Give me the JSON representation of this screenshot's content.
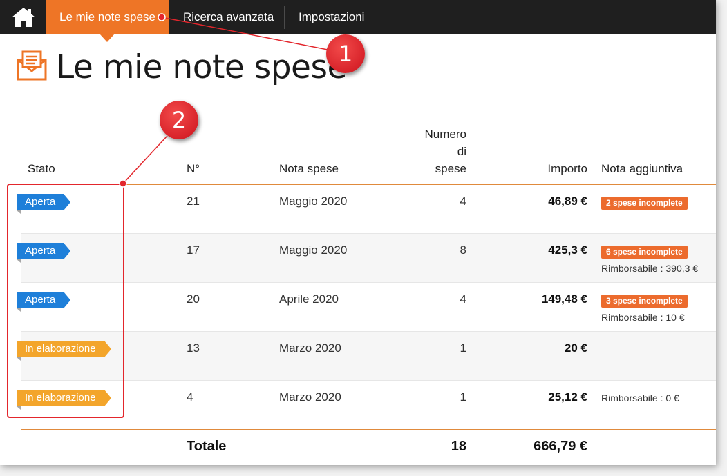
{
  "nav": {
    "home_icon": "home-icon",
    "items": [
      {
        "label": "Le mie note spese",
        "active": true
      },
      {
        "label": "Ricerca avanzata",
        "active": false
      },
      {
        "label": "Impostazioni",
        "active": false
      }
    ]
  },
  "page": {
    "title": "Le mie note spese",
    "title_icon": "expense-note-icon"
  },
  "table": {
    "headers": {
      "stato": "Stato",
      "numero": "N°",
      "nota_spese": "Nota spese",
      "numero_di_spese_1": "Numero",
      "numero_di_spese_2": "di",
      "numero_di_spese_3": "spese",
      "importo": "Importo",
      "nota_aggiuntiva": "Nota aggiuntiva"
    },
    "rows": [
      {
        "stato": "Aperta",
        "stato_color": "#1e7fd9",
        "n": "21",
        "nota": "Maggio 2020",
        "num_spese": "4",
        "importo": "46,89 €",
        "badge": "2 spese incomplete",
        "note": ""
      },
      {
        "stato": "Aperta",
        "stato_color": "#1e7fd9",
        "n": "17",
        "nota": "Maggio 2020",
        "num_spese": "8",
        "importo": "425,3 €",
        "badge": "6 spese incomplete",
        "note": "Rimborsabile : 390,3 €"
      },
      {
        "stato": "Aperta",
        "stato_color": "#1e7fd9",
        "n": "20",
        "nota": "Aprile 2020",
        "num_spese": "4",
        "importo": "149,48 €",
        "badge": "3 spese incomplete",
        "note": "Rimborsabile : 10 €"
      },
      {
        "stato": "In elaborazione",
        "stato_color": "#f3a52b",
        "n": "13",
        "nota": "Marzo 2020",
        "num_spese": "1",
        "importo": "20 €",
        "badge": "",
        "note": ""
      },
      {
        "stato": "In elaborazione",
        "stato_color": "#f3a52b",
        "n": "4",
        "nota": "Marzo 2020",
        "num_spese": "1",
        "importo": "25,12 €",
        "badge": "",
        "note": "Rimborsabile : 0 €"
      }
    ],
    "totals": {
      "label": "Totale",
      "num_spese": "18",
      "importo": "666,79 €"
    }
  },
  "annotations": {
    "callout_1": "1",
    "callout_2": "2",
    "color": "#e3262c"
  },
  "colors": {
    "nav_bg": "#1f1f1f",
    "accent": "#ee7526",
    "badge": "#ec6b2d"
  }
}
